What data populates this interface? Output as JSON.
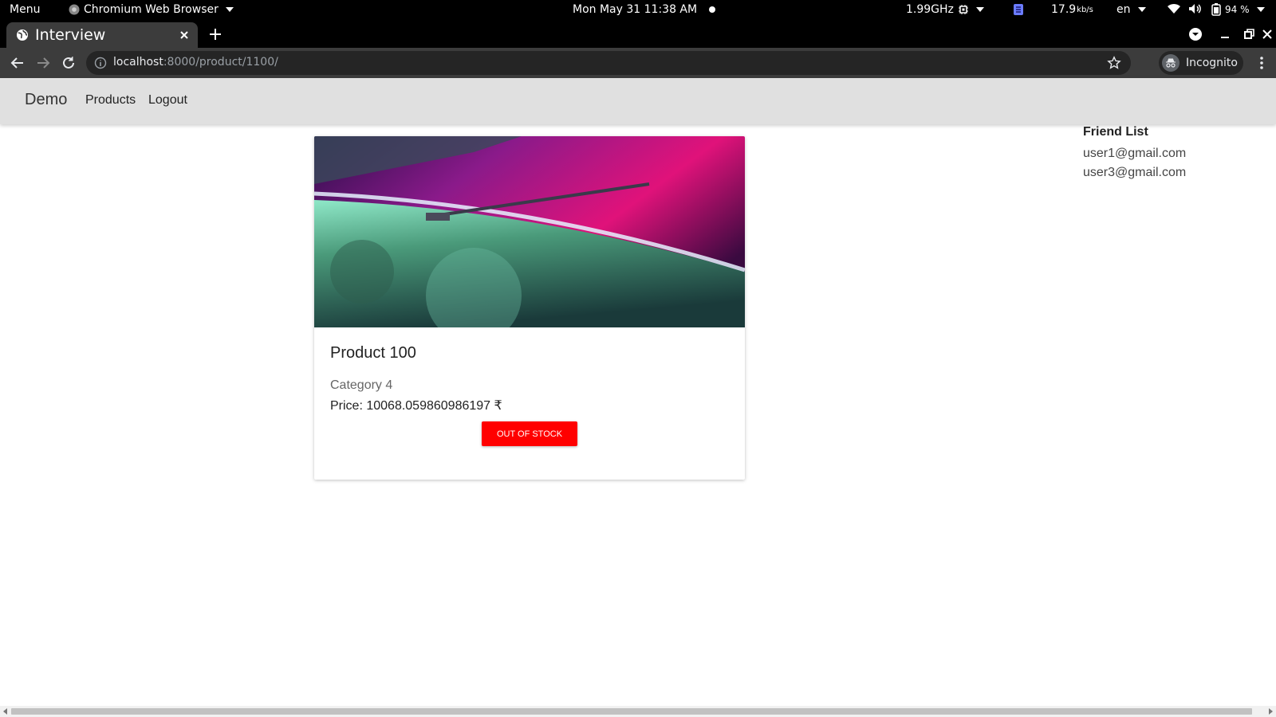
{
  "system_bar": {
    "menu_label": "Menu",
    "app_name": "Chromium Web Browser",
    "datetime": "Mon May 31  11:38 AM",
    "cpu_freq": "1.99GHz",
    "net_speed_value": "17.9",
    "net_speed_unit": "kb/s",
    "keyboard_layout": "en",
    "battery_percent": "94 %"
  },
  "browser": {
    "tab_title": "Interview",
    "url_host": "localhost",
    "url_path": ":8000/product/1100/",
    "profile_label": "Incognito"
  },
  "navbar": {
    "brand": "Demo",
    "links": [
      "Products",
      "Logout"
    ]
  },
  "product": {
    "title": "Product 100",
    "category": "Category 4",
    "price_text": "Price: 10068.059860986197 ₹",
    "button_label": "OUT OF STOCK"
  },
  "friends": {
    "heading": "Friend List",
    "items": [
      "user1@gmail.com",
      "user3@gmail.com"
    ]
  },
  "colors": {
    "stock_button": "#ff0000",
    "navbar_bg": "#e0e0e0",
    "browser_chrome": "#3c3c3c"
  }
}
